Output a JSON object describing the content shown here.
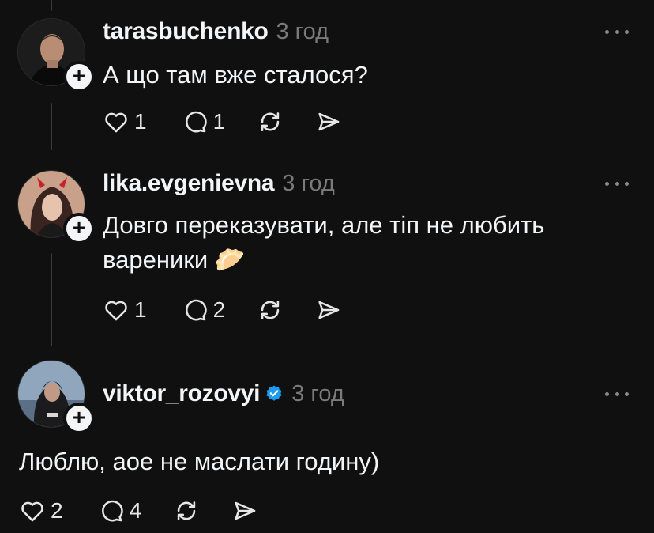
{
  "posts": [
    {
      "username": "tarasbuchenko",
      "time": "3 год",
      "text": "А що там вже сталося?",
      "likes": "1",
      "replies": "1",
      "verified": false
    },
    {
      "username": "lika.evgenievna",
      "time": "3 год",
      "text_line1": "Довго переказувати, але тіп не любить",
      "text_line2": "вареники",
      "emoji": "🥟",
      "likes": "1",
      "replies": "2",
      "verified": false
    },
    {
      "username": "viktor_rozovyi",
      "time": "3 год",
      "text": "Люблю, аое не маслати годину)",
      "likes": "2",
      "replies": "4",
      "verified": true
    }
  ],
  "colors": {
    "background": "#101010",
    "text": "#f3f5f7",
    "muted": "#7a7a7a",
    "verified": "#1d9bf0"
  },
  "icons": [
    "heart-icon",
    "comment-icon",
    "repost-icon",
    "share-icon",
    "more-icon",
    "plus-icon",
    "verified-icon"
  ]
}
